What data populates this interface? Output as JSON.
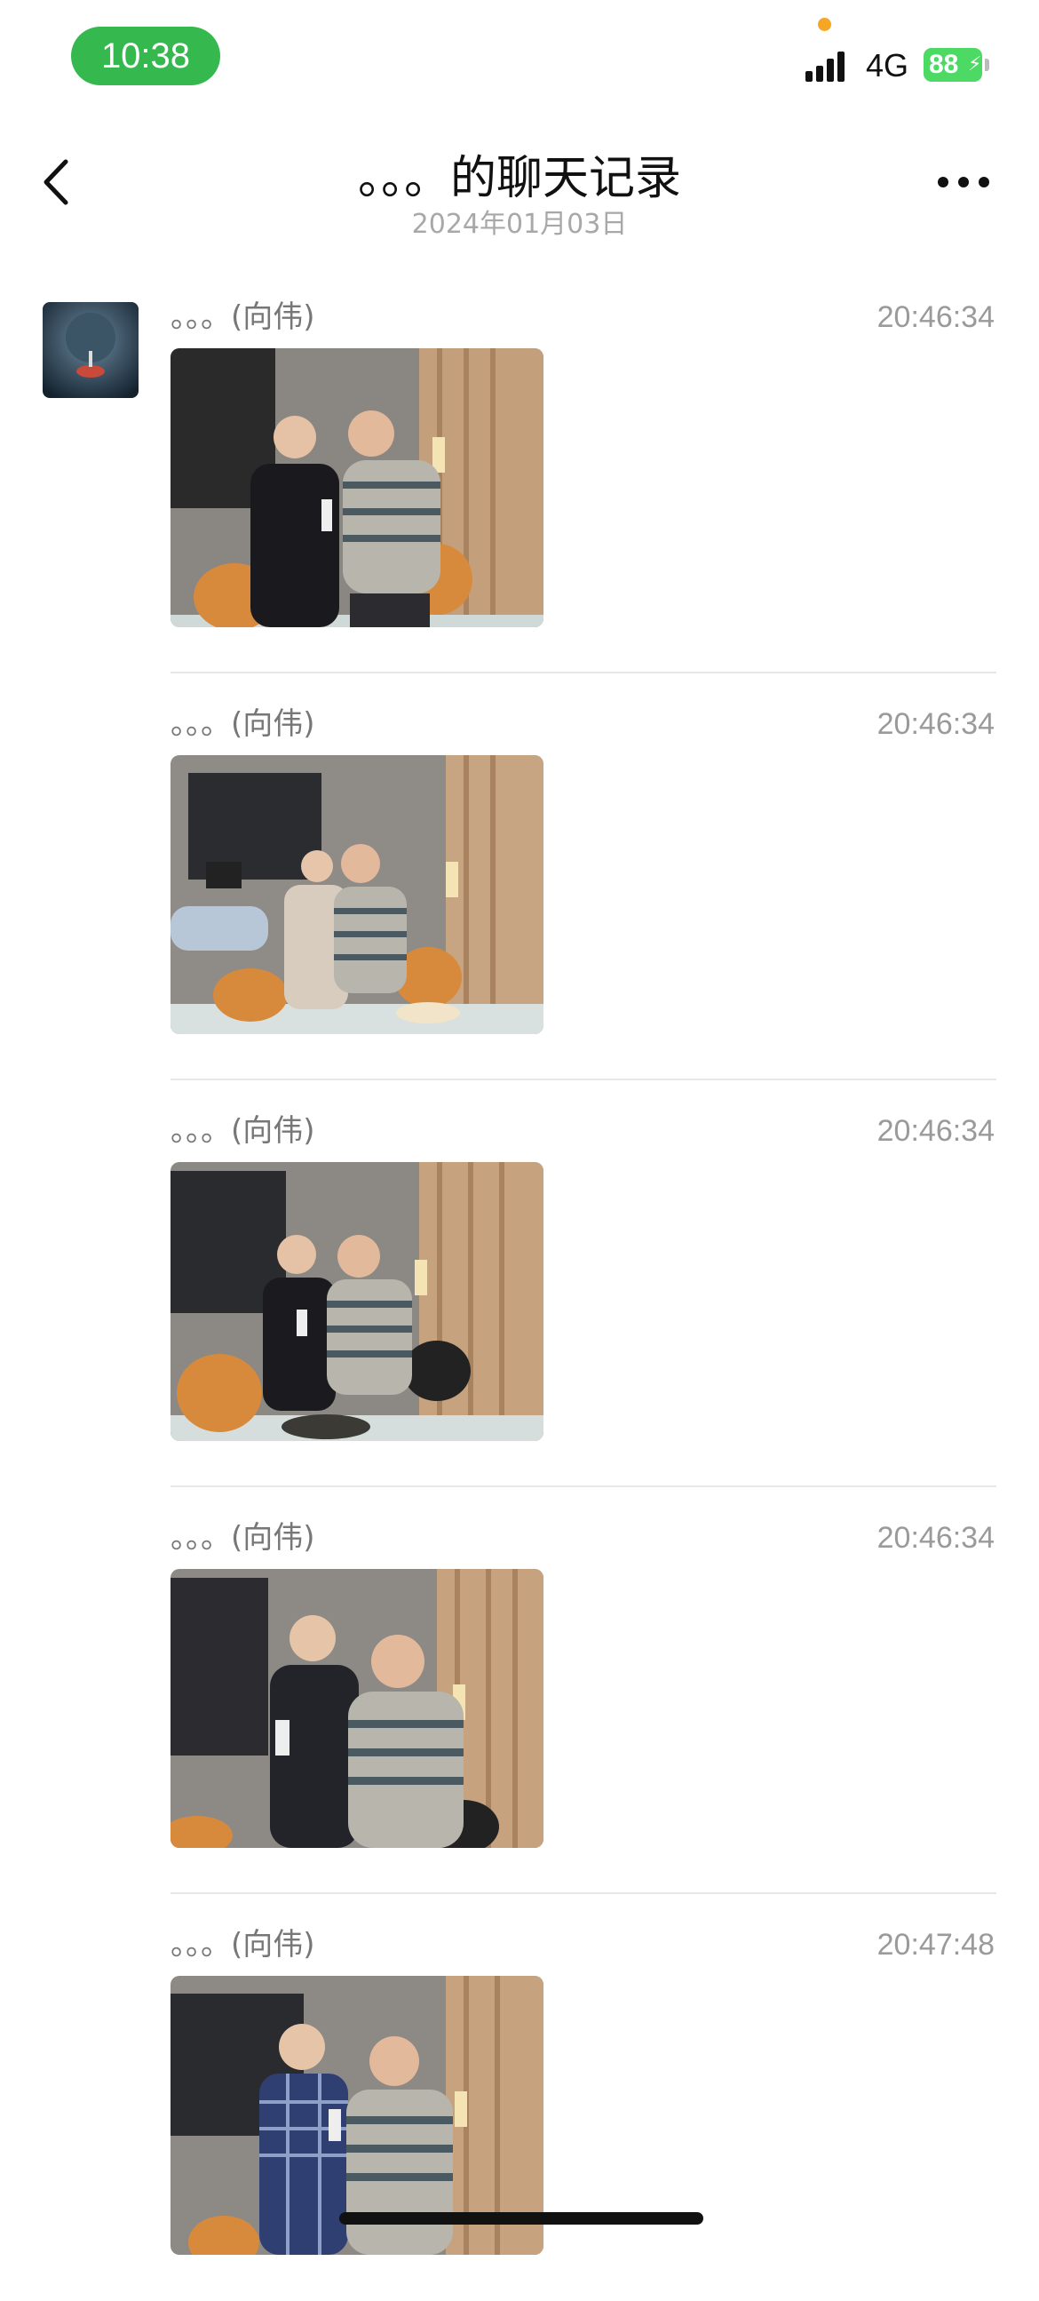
{
  "status_bar": {
    "time": "10:38",
    "network": "4G",
    "battery": "88",
    "accent_color": "#35b84e",
    "battery_color": "#4cd964",
    "privacy_dot_color": "#f5a623"
  },
  "nav": {
    "title": "。。。的聊天记录",
    "subtitle": "2024年01月03日",
    "back_icon": "chevron-left-icon",
    "more_icon": "ellipsis-icon"
  },
  "messages": [
    {
      "sender": "。。。(向伟)",
      "time": "20:46:34",
      "content": "photo"
    },
    {
      "sender": "。。。(向伟)",
      "time": "20:46:34",
      "content": "photo"
    },
    {
      "sender": "。。。(向伟)",
      "time": "20:46:34",
      "content": "photo"
    },
    {
      "sender": "。。。(向伟)",
      "time": "20:46:34",
      "content": "photo"
    },
    {
      "sender": "。。。(向伟)",
      "time": "20:47:48",
      "content": "photo"
    }
  ]
}
